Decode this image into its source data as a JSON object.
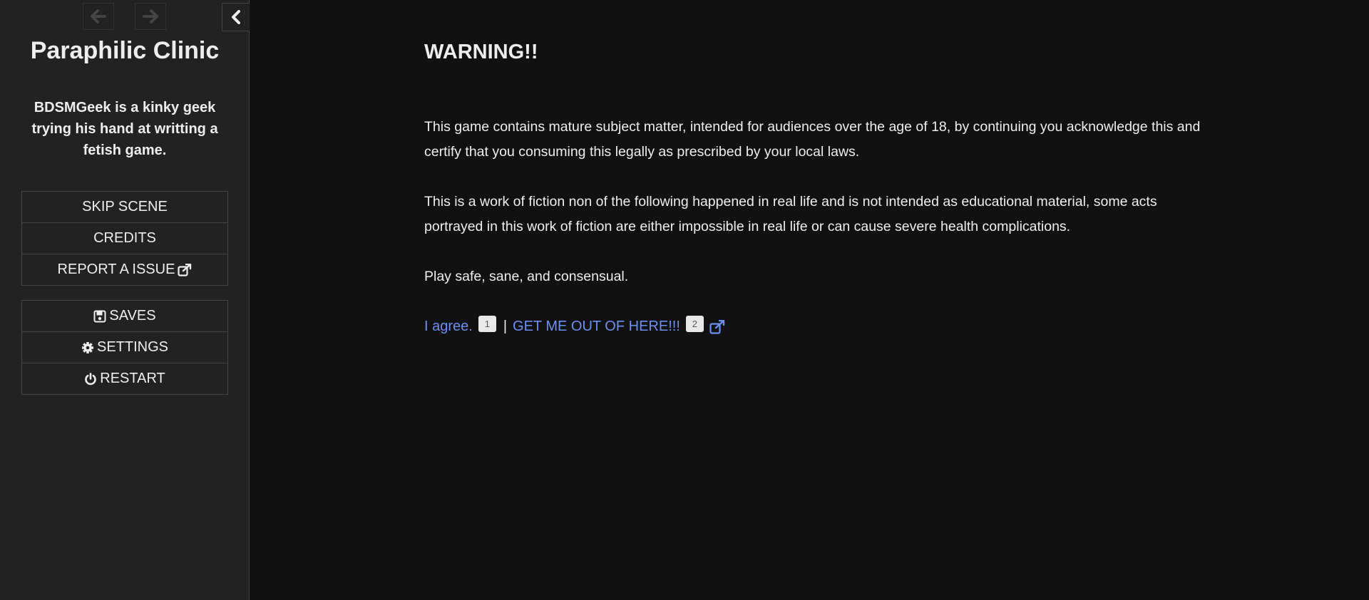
{
  "sidebar": {
    "title": "Paraphilic Clinic",
    "subtitle": "BDSMGeek is a kinky geek trying his hand at writting a fetish game.",
    "story_menu": [
      {
        "label": "SKIP SCENE"
      },
      {
        "label": "CREDITS"
      },
      {
        "label": "REPORT A ISSUE"
      }
    ],
    "core_menu": [
      {
        "label": "SAVES",
        "icon": "floppy-disk-icon"
      },
      {
        "label": "SETTINGS",
        "icon": "gear-icon"
      },
      {
        "label": "RESTART",
        "icon": "power-icon"
      }
    ],
    "nav_icons": {
      "back": "arrow-left-icon",
      "forward": "arrow-right-icon",
      "toggle": "chevron-left-icon"
    }
  },
  "passage": {
    "heading": "WARNING!!",
    "paragraphs": [
      "This game contains mature subject matter, intended for audiences over the age of 18, by continuing you acknowledge this and certify that you consuming this legally as prescribed by your local laws.",
      "This is a work of fiction non of the following happened in real life and is not intended as educational material, some acts portrayed in this work of fiction are either impossible in real life or can cause severe health complications.",
      "Play safe, sane, and consensual."
    ],
    "choices": [
      {
        "label": "I agree.",
        "key": "1"
      },
      {
        "label": "GET ME OUT OF HERE!!!",
        "key": "2",
        "external": true
      }
    ],
    "separator": "|"
  },
  "colors": {
    "background": "#111111",
    "sidebar": "#222222",
    "text": "#eeeeee",
    "link": "#6c8ff0",
    "border": "#444444"
  }
}
